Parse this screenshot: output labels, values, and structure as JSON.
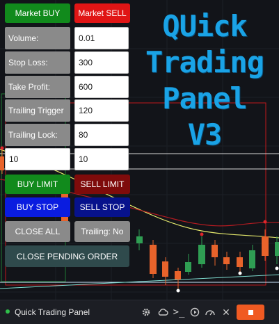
{
  "buttons": {
    "market_buy": "Market BUY",
    "market_sell": "Market SELL",
    "buy_limit": "BUY LIMIT",
    "sell_limit": "SELL LIMIT",
    "buy_stop": "BUY STOP",
    "sell_stop": "SELL STOP",
    "close_all": "CLOSE ALL",
    "trailing": "Trailing: No",
    "close_pending": "CLOSE PENDING ORDER"
  },
  "fields": {
    "volume": {
      "label": "Volume:",
      "value": "0.01"
    },
    "stop_loss": {
      "label": "Stop Loss:",
      "value": "300"
    },
    "take_profit": {
      "label": "Take Profit:",
      "value": "600"
    },
    "trailing_trigger": {
      "label": "Trailing Trigger",
      "value": "120"
    },
    "trailing_lock": {
      "label": "Trailing Lock:",
      "value": "80"
    },
    "pending_left": "10",
    "pending_right": "10"
  },
  "title_lines": [
    "QUick",
    "Trading",
    "Panel",
    "V3"
  ],
  "bottom_bar": {
    "app_title": "Quick Trading Panel",
    "icons": [
      "gear-icon",
      "cloud-icon",
      "console-icon",
      "timer-icon",
      "gauge-icon",
      "close-icon"
    ]
  },
  "colors": {
    "buy_green": "#118a1c",
    "sell_red": "#e01515",
    "limit_dark_red": "#7e0b0b",
    "stop_blue": "#0a1ce0",
    "stop_dark_blue": "#07128c",
    "neutral_grey": "#8a8a8a",
    "pending_teal": "#2f4a4c",
    "title_blue": "#1aa3e6",
    "stop_orange": "#f05a22"
  }
}
